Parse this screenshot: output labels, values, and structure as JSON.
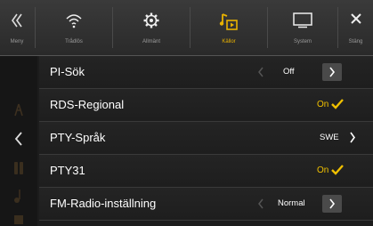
{
  "topbar": {
    "menu_label": "Meny",
    "tabs": [
      {
        "label": "Trådlös",
        "icon": "wifi-icon"
      },
      {
        "label": "Allmänt",
        "icon": "gear-icon"
      },
      {
        "label": "Källor",
        "icon": "sources-icon",
        "active": true
      },
      {
        "label": "System",
        "icon": "monitor-icon"
      }
    ],
    "close_label": "Stäng"
  },
  "settings": [
    {
      "label": "PI-Sök",
      "value": "Off",
      "type": "stepper"
    },
    {
      "label": "RDS-Regional",
      "value": "On",
      "type": "toggle"
    },
    {
      "label": "PTY-Språk",
      "value": "SWE",
      "type": "submenu"
    },
    {
      "label": "PTY31",
      "value": "On",
      "type": "toggle"
    },
    {
      "label": "FM-Radio-inställning",
      "value": "Normal",
      "type": "stepper"
    }
  ],
  "colors": {
    "accent": "#f0c000",
    "background": "#1c1c1c"
  }
}
